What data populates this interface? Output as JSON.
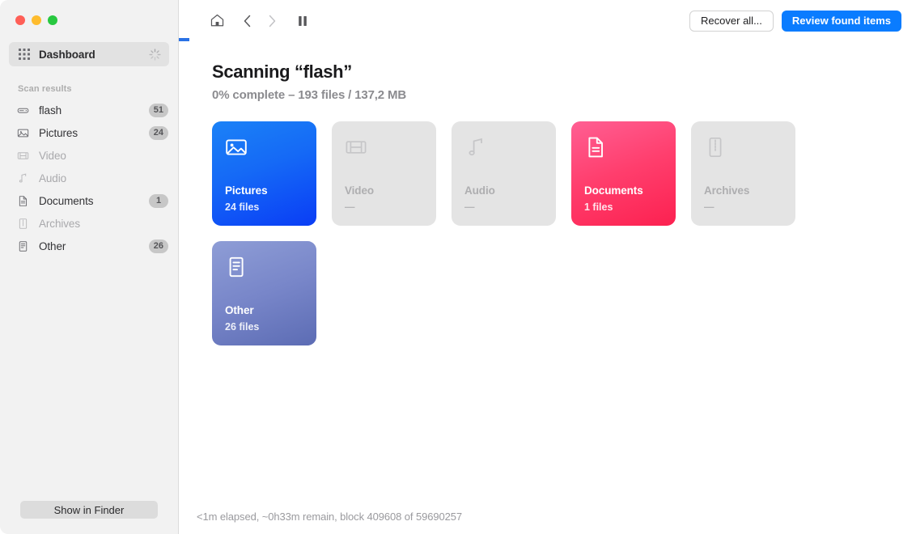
{
  "window": {
    "traffic_lights": [
      "close",
      "minimize",
      "maximize"
    ]
  },
  "sidebar": {
    "dashboard": {
      "label": "Dashboard",
      "icon": "grid-icon",
      "status_icon": "spinner-icon",
      "selected": true
    },
    "section_label": "Scan results",
    "items": [
      {
        "label": "flash",
        "icon": "drive-icon",
        "badge": "51",
        "dim": false
      },
      {
        "label": "Pictures",
        "icon": "picture-icon",
        "badge": "24",
        "dim": false
      },
      {
        "label": "Video",
        "icon": "film-icon",
        "badge": "",
        "dim": true
      },
      {
        "label": "Audio",
        "icon": "music-icon",
        "badge": "",
        "dim": true
      },
      {
        "label": "Documents",
        "icon": "document-icon",
        "badge": "1",
        "dim": false
      },
      {
        "label": "Archives",
        "icon": "archive-icon",
        "badge": "",
        "dim": true
      },
      {
        "label": "Other",
        "icon": "other-icon",
        "badge": "26",
        "dim": false
      }
    ],
    "footer_button": "Show in Finder"
  },
  "toolbar": {
    "home_icon": "home-icon",
    "back_icon": "chevron-left-icon",
    "forward_icon": "chevron-right-icon",
    "pause_icon": "pause-icon",
    "recover_all_label": "Recover all...",
    "review_found_label": "Review found items",
    "accent_color": "#0a7cff"
  },
  "main": {
    "title": "Scanning “flash”",
    "subtitle": "0% complete – 193 files / 137,2 MB",
    "progress_percent": 0,
    "cards": [
      {
        "title": "Pictures",
        "count": "24 files",
        "icon": "picture-icon",
        "state": "filled",
        "accent": "accent-blue",
        "color": "#1569f6"
      },
      {
        "title": "Video",
        "count": "—",
        "icon": "film-icon",
        "state": "empty",
        "accent": "",
        "color": "#e4e4e4"
      },
      {
        "title": "Audio",
        "count": "—",
        "icon": "music-icon",
        "state": "empty",
        "accent": "",
        "color": "#e4e4e4"
      },
      {
        "title": "Documents",
        "count": "1 files",
        "icon": "document-icon",
        "state": "filled",
        "accent": "accent-pink",
        "color": "#ff3e6d"
      },
      {
        "title": "Archives",
        "count": "—",
        "icon": "archive-icon",
        "state": "empty",
        "accent": "",
        "color": "#e4e4e4"
      },
      {
        "title": "Other",
        "count": "26 files",
        "icon": "other-icon",
        "state": "filled",
        "accent": "accent-slate",
        "color": "#7886c9"
      }
    ],
    "status": "<1m elapsed, ~0h33m remain, block 409608 of 59690257"
  }
}
